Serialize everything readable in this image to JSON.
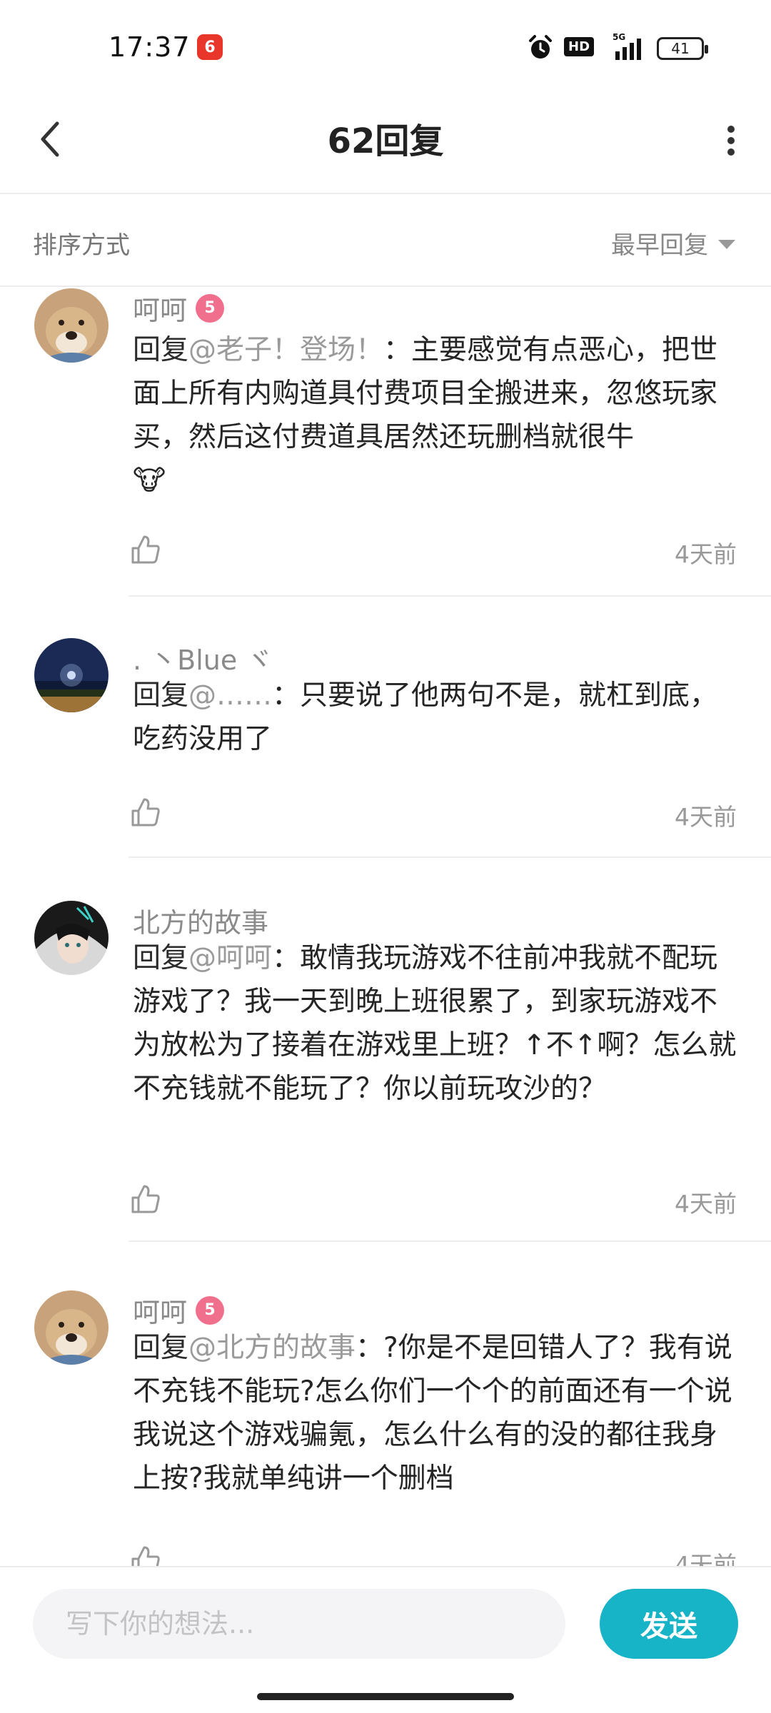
{
  "status_bar": {
    "time": "17:37",
    "app_badge": "6",
    "hd_label": "HD",
    "network": "5G",
    "battery": "41"
  },
  "header": {
    "title": "62回复",
    "back_icon": "chevron-left-icon",
    "more_icon": "more-vertical-icon"
  },
  "sort": {
    "label": "排序方式",
    "selected": "最早回复"
  },
  "comments": [
    {
      "user": "呵呵",
      "badge": "5",
      "prefix": "回复",
      "mention": "@老子！登场！",
      "text": "：主要感觉有点恶心，把世面上所有内购道具付费项目全搬进来，忽悠玩家买，然后这付费道具居然还玩删档就很牛",
      "emoji": "🐮",
      "time": "4天前"
    },
    {
      "user": ". 丶Blue ヾ",
      "prefix": "回复",
      "mention": "@……",
      "text": "：只要说了他两句不是，就杠到底，吃药没用了",
      "time": "4天前"
    },
    {
      "user": "北方的故事",
      "prefix": "回复",
      "mention": "@呵呵",
      "text": "：敢情我玩游戏不往前冲我就不配玩游戏了？我一天到晚上班很累了，到家玩游戏不为放松为了接着在游戏里上班？↑不↑啊？怎么就不充钱就不能玩了？你以前玩攻沙的？",
      "time": "4天前"
    },
    {
      "user": "呵呵",
      "badge": "5",
      "prefix": "回复",
      "mention": "@北方的故事",
      "text": "：?你是不是回错人了？我有说不充钱不能玩?怎么你们一个个的前面还有一个说我说这个游戏骗氪，怎么什么有的没的都往我身上按?我就单纯讲一个删档",
      "time": "4天前"
    }
  ],
  "composer": {
    "placeholder": "写下你的想法...",
    "send_label": "发送"
  }
}
